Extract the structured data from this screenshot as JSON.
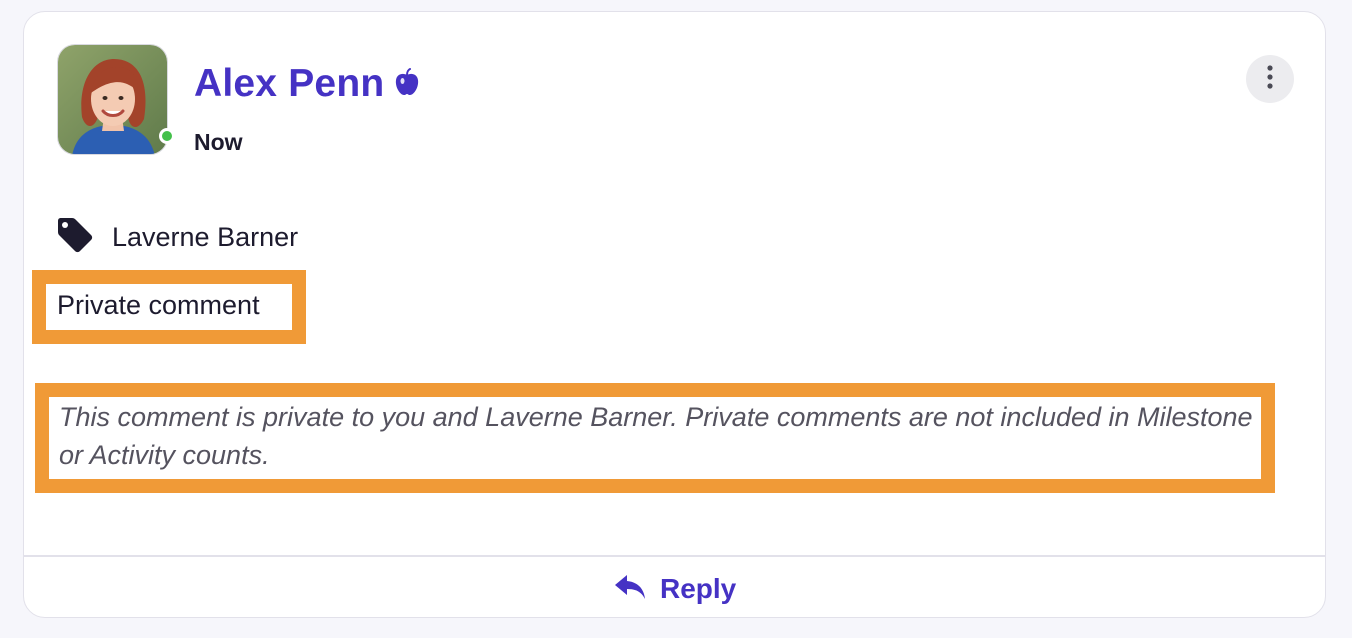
{
  "post": {
    "author": {
      "name": "Alex Penn",
      "badge_icon": "apple-icon",
      "status": "online",
      "avatar_icon": "user-photo"
    },
    "timestamp": "Now",
    "more_icon": "vertical-ellipsis-icon",
    "tag": {
      "icon": "tag-icon",
      "name": "Laverne Barner"
    },
    "visibility_label": "Private comment",
    "privacy_note": "This comment is private to you and Laverne Barner. Private comments are not included in Milestone or Activity counts."
  },
  "footer": {
    "reply_icon": "reply-arrow-icon",
    "reply_label": "Reply"
  },
  "colors": {
    "accent": "#4532c4",
    "presence": "#43c04a",
    "highlight": "#f09a37",
    "text": "#1d1b2e",
    "muted_text": "#55535f"
  }
}
